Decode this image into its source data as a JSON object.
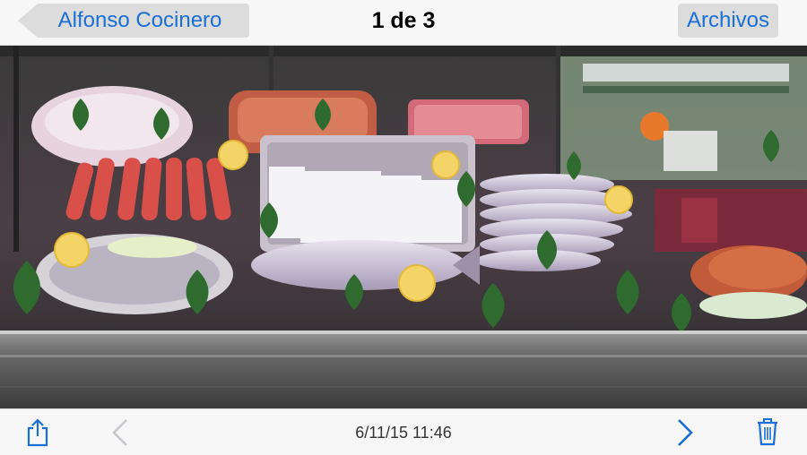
{
  "nav": {
    "back_label": "Alfonso Cocinero",
    "title": "1 de 3",
    "right_label": "Archivos"
  },
  "photo": {
    "description_icon": "photo-fish-display"
  },
  "toolbar": {
    "date": "6/11/15 11:46",
    "icons": [
      "share-icon",
      "chevron-left-icon",
      "chevron-right-icon",
      "trash-icon"
    ],
    "accent": "#1a6fd6",
    "disabled": "#c7c7cc"
  }
}
